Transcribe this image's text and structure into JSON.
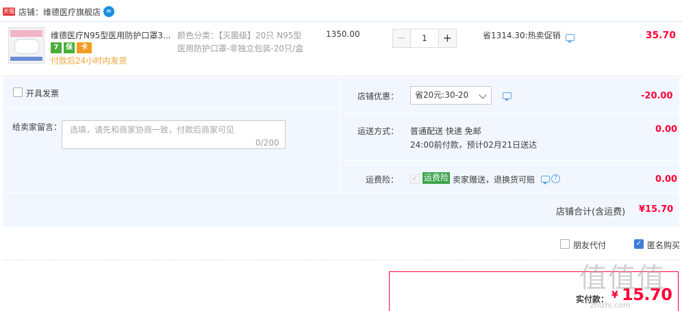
{
  "shop": {
    "platform_badge": "天猫",
    "name": "店铺：维德医疗旗舰店"
  },
  "item": {
    "title": "维德医疗N95型医用防护口罩3...",
    "service_icons": [
      "7",
      "保",
      "卡"
    ],
    "ship_note": "付款后24小时内发货",
    "sku": "颜色分类：【灭菌级】20只 N95型医用防护口罩-非独立包装-20只/盒",
    "unit_price": "1350.00",
    "quantity": "1",
    "minus_label": "−",
    "plus_label": "+",
    "promo": "省1314.30:热卖促销",
    "total": "35.70"
  },
  "options": {
    "invoice_label": "开具发票",
    "message_label": "给卖家留言：",
    "message_placeholder": "选填，请先和商家协商一致，付款后商家可见",
    "message_count": "0/200",
    "coupon_label": "店铺优惠：",
    "coupon_select": "省20元:30-20",
    "coupon_value": "-20.00",
    "shipping_label": "运送方式：",
    "shipping_method": "普通配送 快递 免邮",
    "shipping_eta": "24:00前付款，预计02月21日送达",
    "shipping_value": "0.00",
    "insurance_label": "运费险：",
    "insurance_badge": "运费险",
    "insurance_desc": "卖家赠送，退换货可赔",
    "insurance_value": "0.00",
    "shop_total_label": "店铺合计(含运费)",
    "shop_total_value": "¥15.70"
  },
  "footer": {
    "friend_pay_label": "朋友代付",
    "anonymous_label": "匿名购买",
    "pay_label": "实付款：",
    "pay_currency": "¥",
    "pay_value": "15.70",
    "watermark": "值值值",
    "watermark_sub": "zhizhi.com"
  },
  "colors": {
    "accent_red": "#ff0036",
    "link_blue": "#3f7ed8",
    "panel_bg": "#f2f7ff",
    "ship_orange": "#f2a139"
  }
}
